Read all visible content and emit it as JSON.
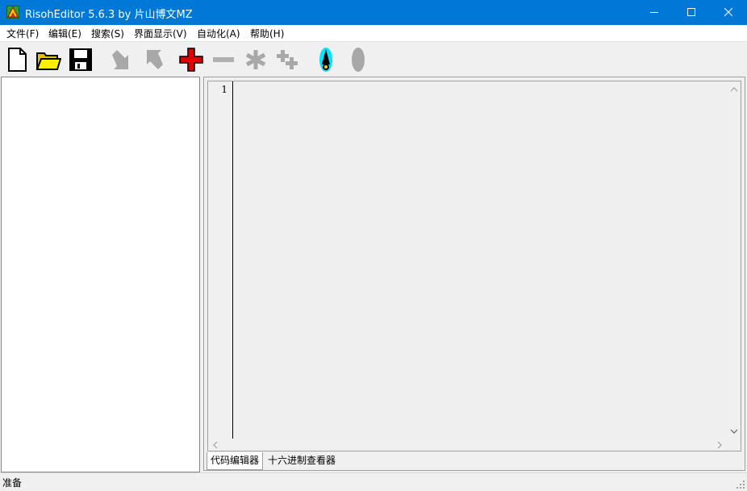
{
  "window": {
    "title": "RisohEditor 5.6.3 by 片山博文MZ",
    "titlebar_color": "#0078d7"
  },
  "menu": {
    "items": [
      "文件(F)",
      "编辑(E)",
      "搜索(S)",
      "界面显示(V)",
      "自动化(A)",
      "帮助(H)"
    ]
  },
  "toolbar": {
    "buttons": [
      {
        "icon": "new-file-icon"
      },
      {
        "icon": "open-folder-icon"
      },
      {
        "icon": "save-disk-icon"
      },
      {
        "icon": "arrow-down-right-icon"
      },
      {
        "icon": "arrow-up-left-icon"
      },
      {
        "icon": "red-plus-icon"
      },
      {
        "icon": "minus-icon"
      },
      {
        "icon": "asterisk-icon"
      },
      {
        "icon": "plus-plus-icon"
      },
      {
        "icon": "compile-icon"
      },
      {
        "icon": "gray-oval-icon"
      }
    ]
  },
  "editor": {
    "line_numbers": [
      "1"
    ],
    "content": ""
  },
  "tabs": [
    "代码编辑器",
    "十六进制查看器"
  ],
  "status": {
    "text": "准备"
  }
}
